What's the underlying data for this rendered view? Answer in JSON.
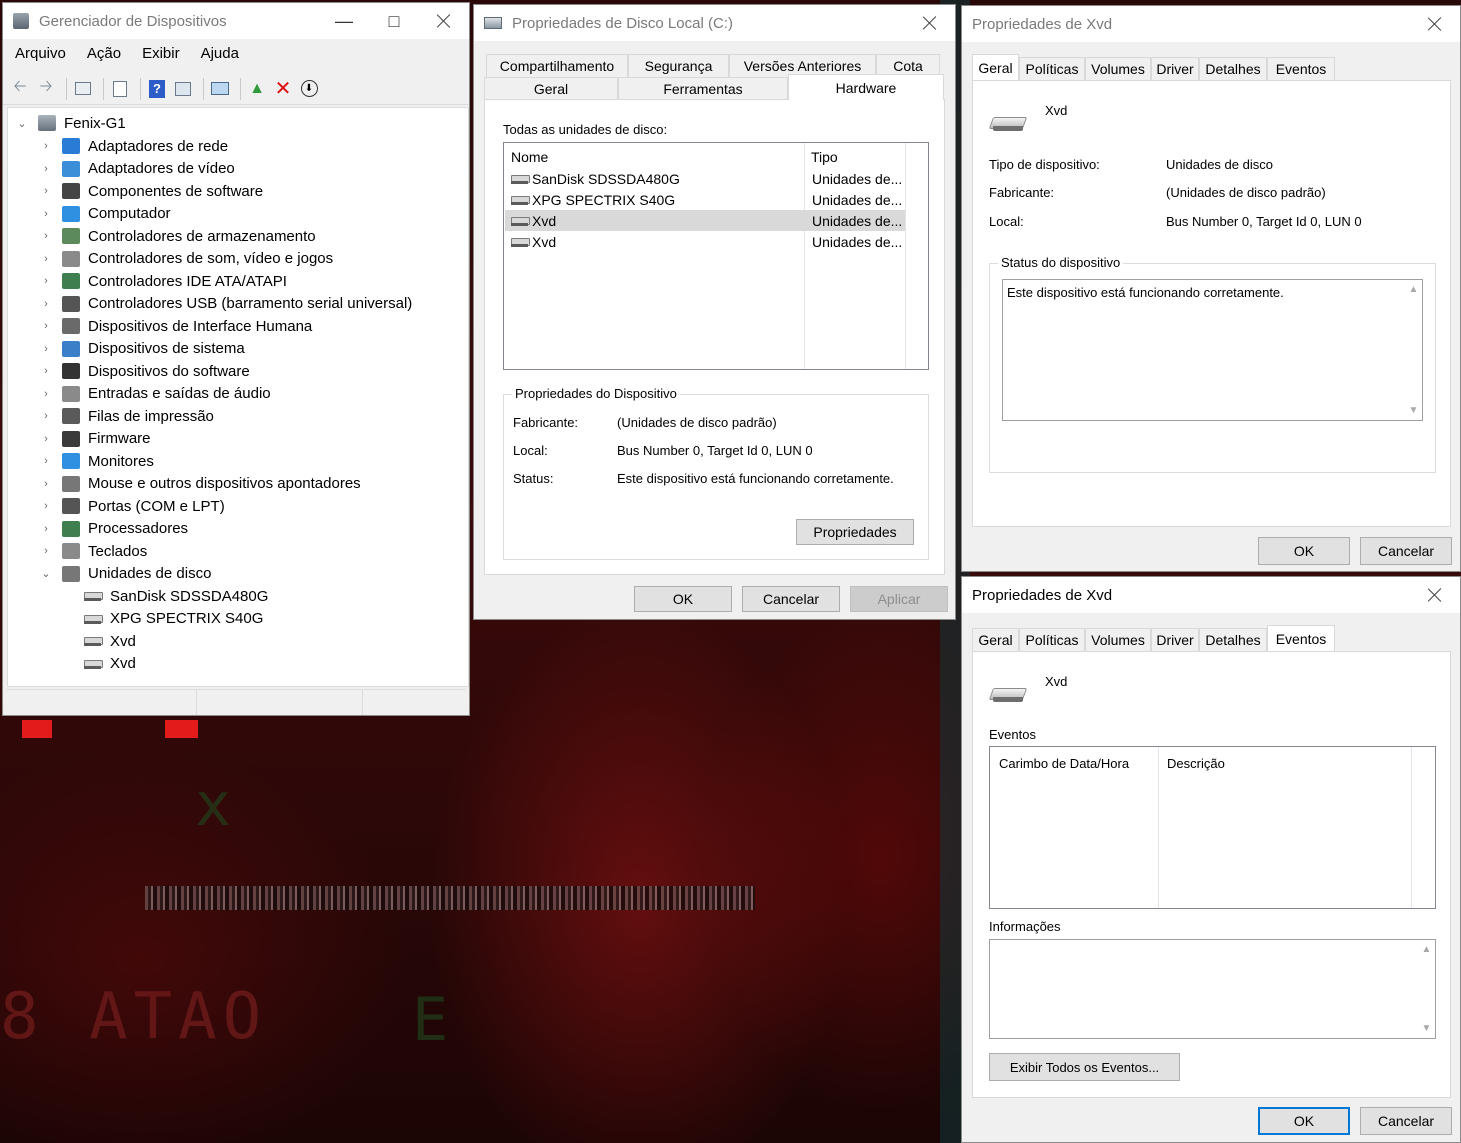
{
  "colors": {
    "accent": "#0078d7",
    "window_bg": "#f0f0f0",
    "selection": "#d9d9d9"
  },
  "device_manager": {
    "title": "Gerenciador de Dispositivos",
    "menu": [
      "Arquivo",
      "Ação",
      "Exibir",
      "Ajuda"
    ],
    "toolbar_icons": [
      "back-arrow-icon",
      "forward-arrow-icon",
      "device-view-icon",
      "properties-icon",
      "help-icon",
      "resources-view-icon",
      "scan-hardware-icon",
      "update-driver-icon",
      "uninstall-device-icon",
      "disable-device-icon"
    ],
    "root": "Fenix-G1",
    "categories": [
      {
        "label": "Adaptadores de rede",
        "icon": "network-adapter-icon",
        "color": "#2a7bd3"
      },
      {
        "label": "Adaptadores de vídeo",
        "icon": "display-adapter-icon",
        "color": "#3a8fd8"
      },
      {
        "label": "Componentes de software",
        "icon": "software-component-icon",
        "color": "#444444"
      },
      {
        "label": "Computador",
        "icon": "computer-icon",
        "color": "#2f8fe0"
      },
      {
        "label": "Controladores de armazenamento",
        "icon": "storage-controller-icon",
        "color": "#5c8a5c"
      },
      {
        "label": "Controladores de som, vídeo e jogos",
        "icon": "speaker-icon",
        "color": "#8a8a8a"
      },
      {
        "label": "Controladores IDE ATA/ATAPI",
        "icon": "ide-controller-icon",
        "color": "#3f7f4f"
      },
      {
        "label": "Controladores USB (barramento serial universal)",
        "icon": "usb-icon",
        "color": "#555555"
      },
      {
        "label": "Dispositivos de Interface Humana",
        "icon": "hid-icon",
        "color": "#6a6a6a"
      },
      {
        "label": "Dispositivos de sistema",
        "icon": "system-device-icon",
        "color": "#3a80c8"
      },
      {
        "label": "Dispositivos do software",
        "icon": "software-device-icon",
        "color": "#333333"
      },
      {
        "label": "Entradas e saídas de áudio",
        "icon": "audio-io-icon",
        "color": "#8a8a8a"
      },
      {
        "label": "Filas de impressão",
        "icon": "printer-icon",
        "color": "#5a5a5a"
      },
      {
        "label": "Firmware",
        "icon": "firmware-icon",
        "color": "#3a3a3a"
      },
      {
        "label": "Monitores",
        "icon": "monitor-icon",
        "color": "#2f8fe0"
      },
      {
        "label": "Mouse e outros dispositivos apontadores",
        "icon": "mouse-icon",
        "color": "#777777"
      },
      {
        "label": "Portas (COM e LPT)",
        "icon": "port-icon",
        "color": "#555555"
      },
      {
        "label": "Processadores",
        "icon": "processor-icon",
        "color": "#3f7f4f"
      },
      {
        "label": "Teclados",
        "icon": "keyboard-icon",
        "color": "#8a8a8a"
      },
      {
        "label": "Unidades de disco",
        "icon": "disk-drive-icon",
        "color": "#777777"
      }
    ],
    "disk_children": [
      "SanDisk SDSSDA480G",
      "XPG SPECTRIX S40G",
      "Xvd",
      "Xvd"
    ]
  },
  "disk_props": {
    "title": "Propriedades de Disco Local (C:)",
    "tabs_row1": [
      "Compartilhamento",
      "Segurança",
      "Versões Anteriores",
      "Cota"
    ],
    "tabs_row2": [
      "Geral",
      "Ferramentas",
      "Hardware"
    ],
    "all_disks_label": "Todas as unidades de disco:",
    "col_name": "Nome",
    "col_type": "Tipo",
    "disks": [
      {
        "name": "SanDisk SDSSDA480G",
        "type": "Unidades de..."
      },
      {
        "name": "XPG SPECTRIX S40G",
        "type": "Unidades de..."
      },
      {
        "name": "Xvd",
        "type": "Unidades de..."
      },
      {
        "name": "Xvd",
        "type": "Unidades de..."
      }
    ],
    "group_title": "Propriedades do Dispositivo",
    "manufacturer_label": "Fabricante:",
    "manufacturer_value": "(Unidades de disco padrão)",
    "location_label": "Local:",
    "location_value": "Bus Number 0, Target Id 0, LUN 0",
    "status_label": "Status:",
    "status_value": "Este dispositivo está funcionando corretamente.",
    "properties_button": "Propriedades",
    "ok": "OK",
    "cancel": "Cancelar",
    "apply": "Aplicar"
  },
  "xvd_general": {
    "title": "Propriedades de Xvd",
    "tabs": [
      "Geral",
      "Políticas",
      "Volumes",
      "Driver",
      "Detalhes",
      "Eventos"
    ],
    "device_name": "Xvd",
    "type_label": "Tipo de dispositivo:",
    "type_value": "Unidades de disco",
    "manufacturer_label": "Fabricante:",
    "manufacturer_value": "(Unidades de disco padrão)",
    "location_label": "Local:",
    "location_value": "Bus Number 0, Target Id 0, LUN 0",
    "status_group": "Status do dispositivo",
    "status_text": "Este dispositivo está funcionando corretamente.",
    "ok": "OK",
    "cancel": "Cancelar"
  },
  "xvd_events": {
    "title": "Propriedades de Xvd",
    "tabs": [
      "Geral",
      "Políticas",
      "Volumes",
      "Driver",
      "Detalhes",
      "Eventos"
    ],
    "device_name": "Xvd",
    "events_label": "Eventos",
    "col_timestamp": "Carimbo de Data/Hora",
    "col_description": "Descrição",
    "info_label": "Informações",
    "show_all_button": "Exibir Todos os Eventos...",
    "ok": "OK",
    "cancel": "Cancelar"
  }
}
